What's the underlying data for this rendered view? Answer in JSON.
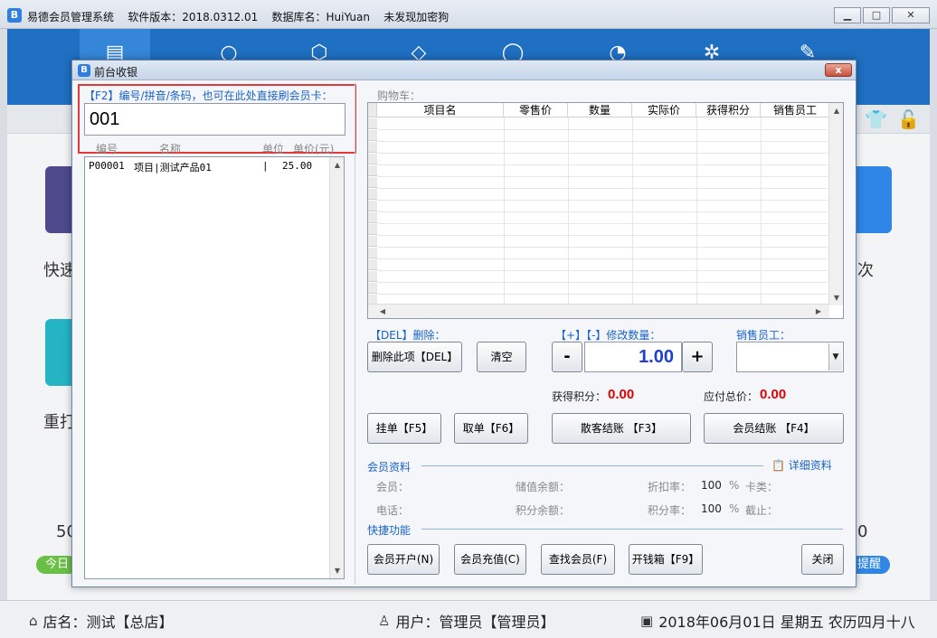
{
  "main_window": {
    "title": "易德会员管理系统    软件版本：2018.0312.01    数据库名：HuiYuan    未发现加密狗",
    "logo_letter": "B",
    "toolbar_icons": [
      "clipboard-icon",
      "zero-icon",
      "box-icon",
      "tag-icon",
      "circle-icon",
      "pie-icon",
      "gear-icon",
      "edit-icon"
    ],
    "tiles_left": [
      {
        "label": "快速",
        "color": "#4e4a8c"
      },
      {
        "label": "重打",
        "color": "#24b4c4"
      }
    ],
    "tile_right": {
      "label": "次",
      "color": "#2f86e6"
    },
    "bignum_left": "50",
    "bignum_right": "0",
    "pill_left": "今日",
    "pill_right": "提醒"
  },
  "statusbar": {
    "shop": "店名：测试【总店】",
    "user": "用户：管理员【管理员】",
    "date": "2018年06月01日 星期五 农历四月十八"
  },
  "dialog": {
    "title": "前台收银",
    "logo_letter": "B",
    "close_label": "x",
    "search_label": "【F2】编号/拼音/条码，也可在此处直接刷会员卡：",
    "search_value": "001",
    "product_columns": [
      "编号",
      "名称",
      "单位",
      "单价(元)"
    ],
    "products": [
      {
        "code": "P00001",
        "name": "项目|测试产品01",
        "unit": "",
        "price": "25.00"
      }
    ],
    "cart_label": "购物车：",
    "cart_columns": [
      "项目名",
      "零售价",
      "数量",
      "实际价",
      "获得积分",
      "销售员工"
    ],
    "del_label": "【DEL】删除：",
    "qty_label": "【+】【-】修改数量：",
    "staff_label": "销售员工：",
    "btn_delete_item": "删除此项【DEL】",
    "btn_clear": "清空",
    "btn_minus": "-",
    "qty_value": "1.00",
    "btn_plus": "+",
    "points_label": "获得积分：",
    "points_value": "0.00",
    "total_label": "应付总价：",
    "total_value": "0.00",
    "btn_hold": "挂单【F5】",
    "btn_retrieve": "取单【F6】",
    "btn_guest_checkout": "散客结账 【F3】",
    "btn_member_checkout": "会员结账 【F4】",
    "member_section": "会员资料",
    "detail_link": "详细资料",
    "member_label": "会员：",
    "balance_label": "储值余额：",
    "discount_label": "折扣率：",
    "discount_value": "100",
    "percent_sign": "%",
    "card_type_label": "卡类：",
    "phone_label": "电话：",
    "points_balance_label": "积分余额：",
    "points_rate_label": "积分率：",
    "points_rate_value": "100",
    "expiry_label": "截止：",
    "quick_section": "快捷功能",
    "btn_open_account": "会员开户(N)",
    "btn_recharge": "会员充值(C)",
    "btn_find_member": "查找会员(F)",
    "btn_cash_drawer": "开钱箱【F9】",
    "btn_close": "关闭"
  }
}
